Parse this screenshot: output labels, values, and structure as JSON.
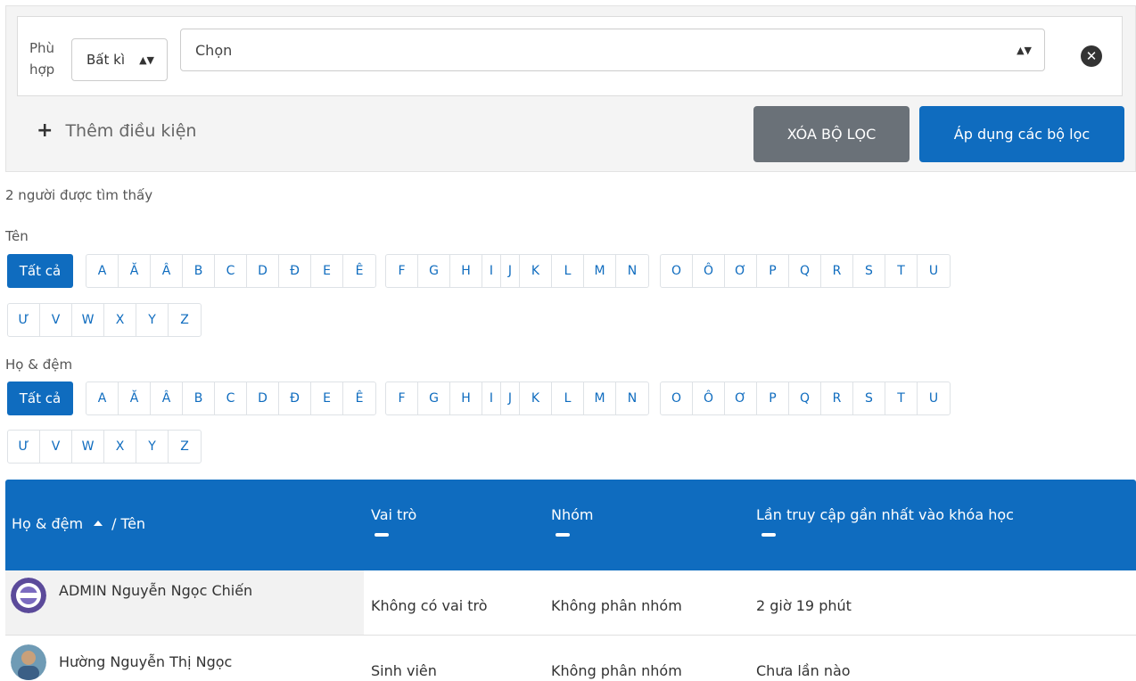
{
  "filter": {
    "match_label_line1": "Phù",
    "match_label_line2": "hợp",
    "match_value": "Bất kì",
    "choose_value": "Chọn",
    "add_condition": "Thêm điều kiện",
    "clear_button": "XÓA BỘ LỌC",
    "apply_button": "Áp dụng các bộ lọc"
  },
  "found_text": "2 người được tìm thấy",
  "firstname_bar": {
    "label": "Tên",
    "all": "Tất cả"
  },
  "lastname_bar": {
    "label": "Họ & đệm",
    "all": "Tất cả"
  },
  "letters": {
    "group1": [
      "A",
      "Ă",
      "Â",
      "B",
      "C",
      "D",
      "Đ",
      "E",
      "Ê"
    ],
    "group2": [
      "F",
      "G",
      "H",
      "I",
      "J",
      "K",
      "L",
      "M",
      "N"
    ],
    "group3": [
      "O",
      "Ô",
      "Ơ",
      "P",
      "Q",
      "R",
      "S",
      "T",
      "U"
    ],
    "group4": [
      "Ư",
      "V",
      "W",
      "X",
      "Y",
      "Z"
    ]
  },
  "table": {
    "header_name_first": "Họ & đệm",
    "header_name_sep": "/ Tên",
    "header_role": "Vai trò",
    "header_group": "Nhóm",
    "header_last_access": "Lần truy cập gần nhất vào khóa học",
    "rows": [
      {
        "name": "ADMIN Nguyễn Ngọc Chiến",
        "role": "Không có vai trò",
        "group": "Không phân nhóm",
        "last_access": "2 giờ 19 phút"
      },
      {
        "name": "Hường Nguyễn Thị Ngọc",
        "role": "Sinh viên",
        "group": "Không phân nhóm",
        "last_access": "Chưa lần nào"
      }
    ]
  },
  "colors": {
    "primary": "#0f6cbf",
    "secondary": "#6a7178"
  }
}
